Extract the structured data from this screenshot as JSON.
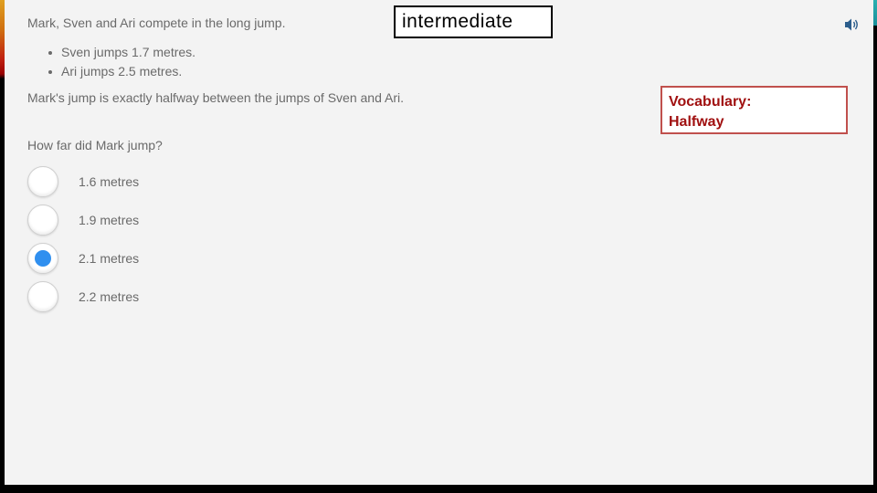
{
  "question": {
    "intro": "Mark, Sven and Ari compete in the long jump.",
    "facts": [
      "Sven jumps 1.7 metres.",
      "Ari jumps 2.5 metres."
    ],
    "statement": "Mark's jump is exactly halfway between the jumps of Sven and Ari.",
    "prompt": "How far did Mark jump?",
    "options": [
      {
        "label": "1.6 metres",
        "selected": false
      },
      {
        "label": "1.9 metres",
        "selected": false
      },
      {
        "label": "2.1 metres",
        "selected": true
      },
      {
        "label": "2.2 metres",
        "selected": false
      }
    ]
  },
  "level_label": "intermediate",
  "vocabulary": {
    "title": "Vocabulary:",
    "word": "Halfway"
  },
  "icons": {
    "audio": "speaker-icon"
  },
  "colors": {
    "selected_radio": "#2f8fef",
    "vocab_text": "#a01010",
    "vocab_border": "#c0504d"
  }
}
